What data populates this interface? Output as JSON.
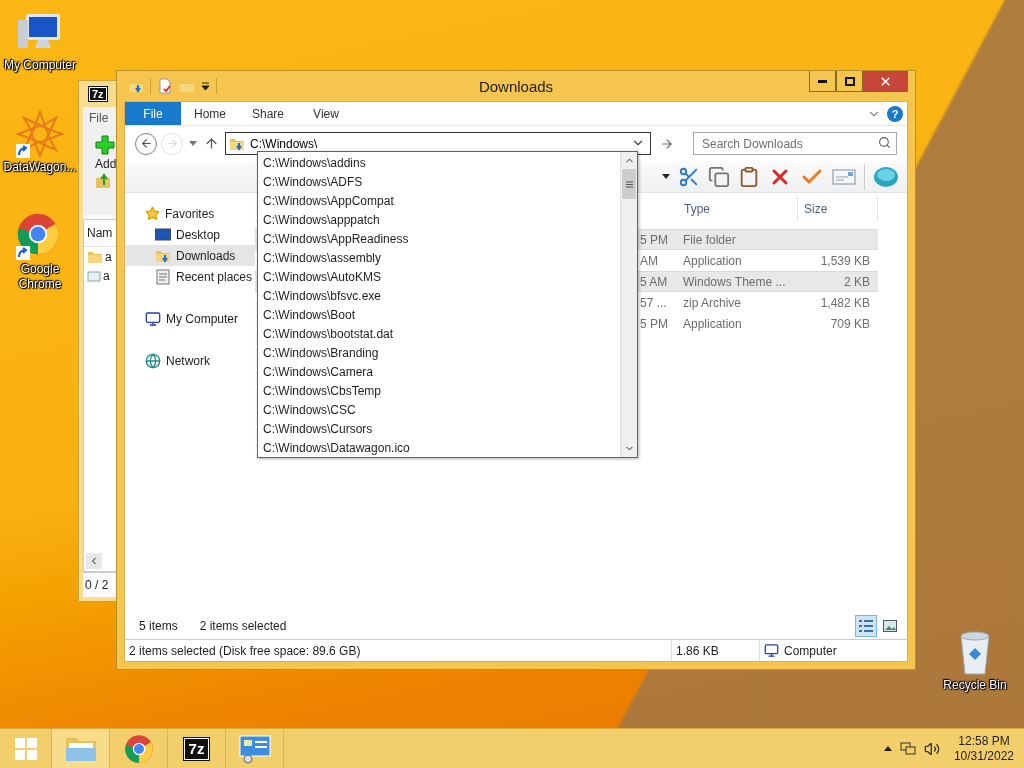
{
  "desktop_icons": [
    {
      "kind": "computer",
      "label": "My Computer",
      "shortcut": false
    },
    {
      "kind": "datawagon",
      "label": "DataWagon...",
      "shortcut": true
    },
    {
      "kind": "chrome",
      "label": "Google Chrome",
      "shortcut": true
    },
    {
      "kind": "recycle",
      "label": "Recycle Bin",
      "shortcut": false
    }
  ],
  "archiver_window": {
    "logo_text": "7z",
    "menu": "File",
    "add_label": "Add",
    "column": "Nam",
    "rows": [
      "a",
      "a"
    ],
    "status": "0 / 2"
  },
  "explorer": {
    "title": "Downloads",
    "ribbon_tabs": [
      {
        "label": "File",
        "selected": true
      },
      {
        "label": "Home",
        "selected": false
      },
      {
        "label": "Share",
        "selected": false
      },
      {
        "label": "View",
        "selected": false
      }
    ],
    "help_glyph": "?",
    "forward_disabled": true,
    "address": "C:\\Windows\\",
    "search": {
      "placeholder": "Search Downloads"
    },
    "nav": [
      {
        "label": "Favorites",
        "kind": "star",
        "selected": false,
        "children": [
          {
            "label": "Desktop",
            "kind": "desktop",
            "selected": false
          },
          {
            "label": "Downloads",
            "kind": "downloads",
            "selected": true
          },
          {
            "label": "Recent places",
            "kind": "recent",
            "selected": false
          }
        ]
      },
      {
        "label": "My Computer",
        "kind": "computer",
        "selected": false
      },
      {
        "label": "Network",
        "kind": "network",
        "selected": false
      }
    ],
    "columns": [
      "Type",
      "Size"
    ],
    "rows": [
      {
        "date": "5 PM",
        "type": "File folder",
        "size": "",
        "selected": true
      },
      {
        "date": "AM",
        "type": "Application",
        "size": "1,539 KB",
        "selected": false
      },
      {
        "date": "5 AM",
        "type": "Windows Theme ...",
        "size": "2 KB",
        "selected": true
      },
      {
        "date": "57 ...",
        "type": "zip Archive",
        "size": "1,482 KB",
        "selected": false
      },
      {
        "date": "5 PM",
        "type": "Application",
        "size": "709 KB",
        "selected": false
      }
    ],
    "item_count": "5 items",
    "selected_count": "2 items selected",
    "views": [
      {
        "kind": "details",
        "selected": true
      },
      {
        "kind": "thumbnails",
        "selected": false
      }
    ],
    "status_bar": {
      "text": "2 items selected (Disk free space: 89.6 GB)",
      "size": "1.86 KB",
      "zone": "Computer"
    }
  },
  "autocomplete": {
    "items": [
      "C:\\Windows\\addins",
      "C:\\Windows\\ADFS",
      "C:\\Windows\\AppCompat",
      "C:\\Windows\\apppatch",
      "C:\\Windows\\AppReadiness",
      "C:\\Windows\\assembly",
      "C:\\Windows\\AutoKMS",
      "C:\\Windows\\bfsvc.exe",
      "C:\\Windows\\Boot",
      "C:\\Windows\\bootstat.dat",
      "C:\\Windows\\Branding",
      "C:\\Windows\\Camera",
      "C:\\Windows\\CbsTemp",
      "C:\\Windows\\CSC",
      "C:\\Windows\\Cursors",
      "C:\\Windows\\Datawagon.ico"
    ]
  },
  "taskbar": {
    "apps": [
      {
        "kind": "explorer"
      },
      {
        "kind": "chrome"
      },
      {
        "kind": "archiver",
        "logo_text": "7z"
      },
      {
        "kind": "control_panel"
      }
    ],
    "clock": {
      "time": "12:58 PM",
      "date": "10/31/2022"
    }
  }
}
